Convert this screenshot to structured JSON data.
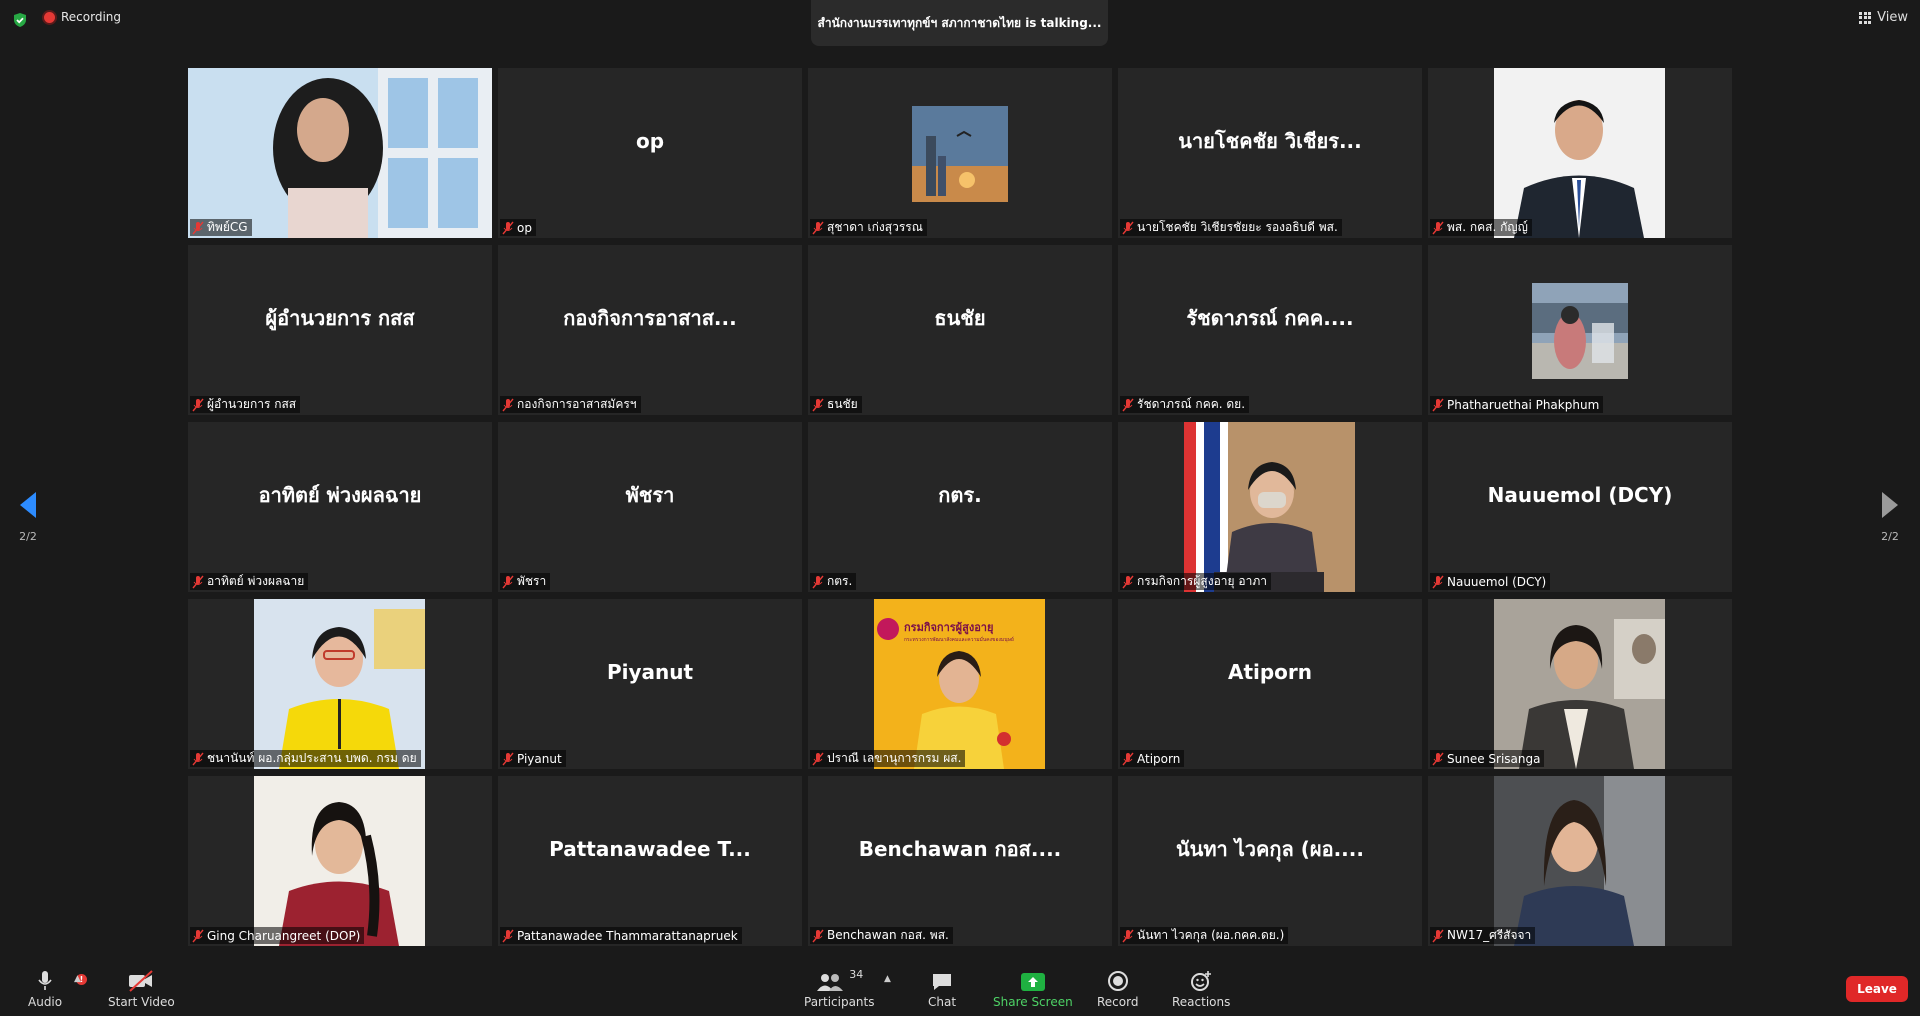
{
  "top": {
    "recording_label": "Recording",
    "talking_text": "สำนักงานบรรเทาทุกข์ฯ สภากาชาดไทย is  talking...",
    "view_label": "View"
  },
  "nav": {
    "page_indicator_left": "2/2",
    "page_indicator_right": "2/2"
  },
  "tiles": [
    {
      "big": "",
      "label": "ทิพย์CG"
    },
    {
      "big": "op",
      "label": "op"
    },
    {
      "big": "",
      "label": "สุชาดา เก่งสุวรรณ"
    },
    {
      "big": "นายโชคชัย วิเชียร...",
      "label": "นายโชคชัย วิเชียรชัยยะ รองอธิบดี พส."
    },
    {
      "big": "",
      "label": "พส. กคส. กัญญ์"
    },
    {
      "big": "ผู้อำนวยการ กสส",
      "label": "ผู้อำนวยการ กสส"
    },
    {
      "big": "กองกิจการอาสาส...",
      "label": "กองกิจการอาสาสมัครฯ"
    },
    {
      "big": "ธนชัย",
      "label": "ธนชัย"
    },
    {
      "big": "รัชดาภรณ์   กคค....",
      "label": "รัชดาภรณ์   กคค. ดย."
    },
    {
      "big": "",
      "label": "Phatharuethai Phakphum"
    },
    {
      "big": "อาทิตย์ พ่วงผลฉาย",
      "label": "อาทิตย์ พ่วงผลฉาย"
    },
    {
      "big": "พัชรา",
      "label": "พัชรา"
    },
    {
      "big": "กตร.",
      "label": "กตร."
    },
    {
      "big": "",
      "label": "กรมกิจการผู้สูงอายุ อาภา"
    },
    {
      "big": "Nauuemol (DCY)",
      "label": "Nauuemol (DCY)"
    },
    {
      "big": "",
      "label": "ชนานันท์ ผอ.กลุ่มประสาน บพด. กรม ดย"
    },
    {
      "big": "Piyanut",
      "label": "Piyanut"
    },
    {
      "big": "",
      "label": "ปราณี เลขานุการกรม ผส."
    },
    {
      "big": "Atiporn",
      "label": "Atiporn"
    },
    {
      "big": "",
      "label": "Sunee Srisanga"
    },
    {
      "big": "",
      "label": "Ging Charuangreet (DOP)"
    },
    {
      "big": "Pattanawadee T...",
      "label": "Pattanawadee Thammarattanapruek"
    },
    {
      "big": "Benchawan กอส....",
      "label": "Benchawan กอส. พส."
    },
    {
      "big": "นันทา ไวคกุล (ผอ....",
      "label": "นันทา ไวคกุล (ผอ.กคค.ดย.)"
    },
    {
      "big": "",
      "label": "NW17_ศรีสัจจา"
    }
  ],
  "poster": {
    "title": "กรมกิจการผู้สูงอายุ",
    "subtitle": "กระทรวงการพัฒนาสังคมและความมั่นคงของมนุษย์"
  },
  "toolbar": {
    "audio": "Audio",
    "audio_badge": "!",
    "video": "Start Video",
    "participants": "Participants",
    "participant_count": "34",
    "chat": "Chat",
    "share": "Share Screen",
    "record": "Record",
    "reactions": "Reactions",
    "leave": "Leave"
  },
  "colors": {
    "accent_green": "#4ed266",
    "leave_red": "#e02828",
    "nav_blue": "#2d8cff"
  }
}
